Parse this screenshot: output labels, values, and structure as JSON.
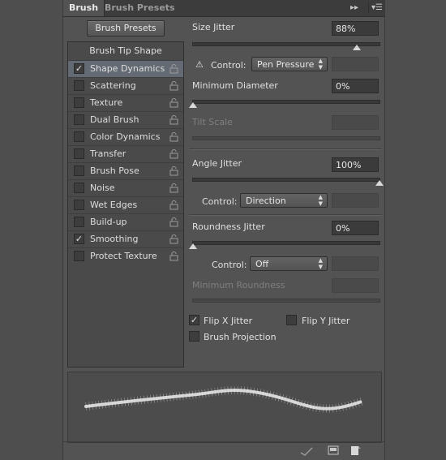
{
  "tabs": [
    "Brush",
    "Brush Presets"
  ],
  "brush_presets_button": "Brush Presets",
  "brush_tip_shape": "Brush Tip Shape",
  "options": [
    {
      "label": "Shape Dynamics",
      "checked": true,
      "selected": true
    },
    {
      "label": "Scattering",
      "checked": false
    },
    {
      "label": "Texture",
      "checked": false
    },
    {
      "label": "Dual Brush",
      "checked": false
    },
    {
      "label": "Color Dynamics",
      "checked": false
    },
    {
      "label": "Transfer",
      "checked": false
    },
    {
      "label": "Brush Pose",
      "checked": false
    },
    {
      "label": "Noise",
      "checked": false
    },
    {
      "label": "Wet Edges",
      "checked": false
    },
    {
      "label": "Build-up",
      "checked": false
    },
    {
      "label": "Smoothing",
      "checked": true
    },
    {
      "label": "Protect Texture",
      "checked": false
    }
  ],
  "size_jitter": {
    "label": "Size Jitter",
    "value": "88%",
    "slider": 0.88
  },
  "control1": {
    "label": "Control:",
    "value": "Pen Pressure"
  },
  "min_diameter": {
    "label": "Minimum Diameter",
    "value": "0%",
    "slider": 0.0
  },
  "tilt_scale": {
    "label": "Tilt Scale"
  },
  "angle_jitter": {
    "label": "Angle Jitter",
    "value": "100%",
    "slider": 1.0
  },
  "control2": {
    "label": "Control:",
    "value": "Direction"
  },
  "roundness_jitter": {
    "label": "Roundness Jitter",
    "value": "0%",
    "slider": 0.0
  },
  "control3": {
    "label": "Control:",
    "value": "Off"
  },
  "min_roundness": {
    "label": "Minimum Roundness"
  },
  "flip_x": {
    "label": "Flip X Jitter",
    "checked": true
  },
  "flip_y": {
    "label": "Flip Y Jitter",
    "checked": false
  },
  "brush_projection": {
    "label": "Brush Projection",
    "checked": false
  },
  "check_glyph": "✓"
}
